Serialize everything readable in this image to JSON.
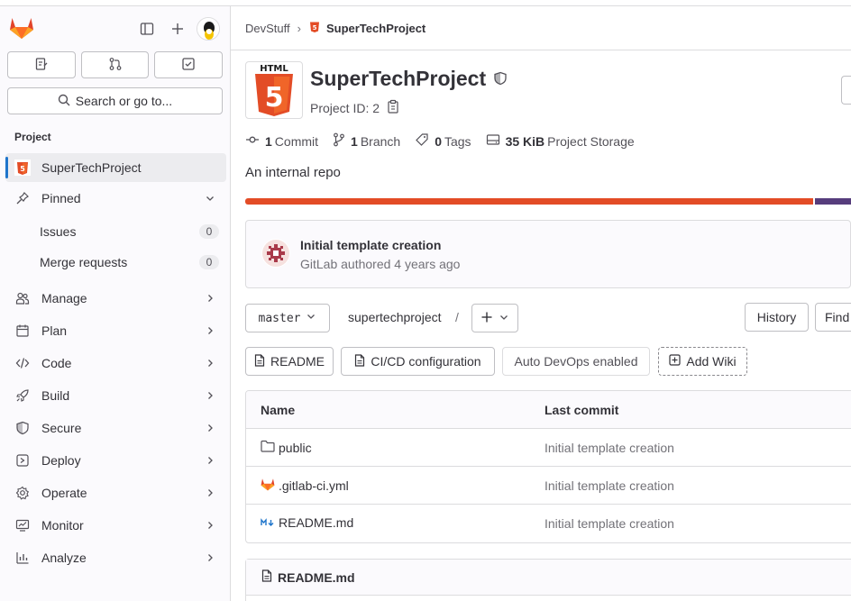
{
  "sidebar": {
    "search_label": "Search or go to...",
    "section_title": "Project",
    "project_name": "SuperTechProject",
    "pinned_label": "Pinned",
    "pinned_items": [
      {
        "label": "Issues",
        "count": "0"
      },
      {
        "label": "Merge requests",
        "count": "0"
      }
    ],
    "nav": [
      {
        "label": "Manage",
        "icon": "users-icon"
      },
      {
        "label": "Plan",
        "icon": "calendar-icon"
      },
      {
        "label": "Code",
        "icon": "code-icon"
      },
      {
        "label": "Build",
        "icon": "rocket-icon"
      },
      {
        "label": "Secure",
        "icon": "shield-icon"
      },
      {
        "label": "Deploy",
        "icon": "deploy-icon"
      },
      {
        "label": "Operate",
        "icon": "cloud-gear-icon"
      },
      {
        "label": "Monitor",
        "icon": "monitor-icon"
      },
      {
        "label": "Analyze",
        "icon": "chart-icon"
      }
    ]
  },
  "breadcrumb": {
    "group": "DevStuff",
    "project": "SuperTechProject"
  },
  "project": {
    "avatar_text": "HTML",
    "avatar_number": "5",
    "title": "SuperTechProject",
    "id_label": "Project ID: 2",
    "description": "An internal repo",
    "stats": {
      "commits_count": "1",
      "commits_label": "Commit",
      "branches_count": "1",
      "branches_label": "Branch",
      "tags_count": "0",
      "tags_label": "Tags",
      "storage_size": "35 KiB",
      "storage_label": "Project Storage"
    },
    "language_bar": [
      {
        "color": "#e34c26",
        "share": 0.94
      },
      {
        "color": "#563d7c",
        "share": 0.06
      }
    ]
  },
  "last_commit": {
    "title": "Initial template creation",
    "author": "GitLab",
    "meta_text": "GitLab authored 4 years ago"
  },
  "repo_toolbar": {
    "branch": "master",
    "path": "supertechproject",
    "path_sep": "/",
    "history_label": "History",
    "find_label": "Find"
  },
  "quick_actions": {
    "readme": "README",
    "ci": "CI/CD configuration",
    "devops": "Auto DevOps enabled",
    "wiki": "Add Wiki"
  },
  "file_table": {
    "headers": {
      "name": "Name",
      "last_commit": "Last commit"
    },
    "rows": [
      {
        "name": "public",
        "icon": "folder-icon",
        "commit": "Initial template creation"
      },
      {
        "name": ".gitlab-ci.yml",
        "icon": "gitlab-icon",
        "commit": "Initial template creation"
      },
      {
        "name": "README.md",
        "icon": "markdown-icon",
        "commit": "Initial template creation"
      }
    ]
  },
  "readme": {
    "filename": "README.md"
  },
  "colors": {
    "accent": "#1f75cb",
    "gitlab_orange": "#fc6d26",
    "html_orange": "#e34c26"
  }
}
